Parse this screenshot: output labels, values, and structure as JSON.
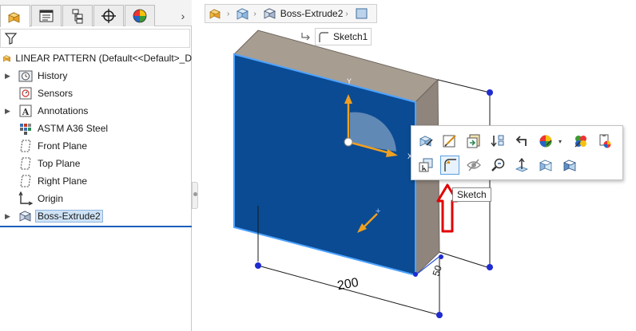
{
  "panel_tabs": [
    {
      "name": "featuremanager",
      "icon": "part-icon"
    },
    {
      "name": "propertymanager",
      "icon": "property-manager-icon"
    },
    {
      "name": "configurationmanager",
      "icon": "configuration-icon"
    },
    {
      "name": "dimxpertmanager",
      "icon": "crosshair-icon"
    },
    {
      "name": "displaymanager",
      "icon": "appearance-icon"
    }
  ],
  "tree": {
    "root": "LINEAR PATTERN  (Default<<Default>_D",
    "items": [
      {
        "label": "History",
        "icon": "history-folder-icon",
        "expandable": true
      },
      {
        "label": "Sensors",
        "icon": "sensor-icon",
        "expandable": false
      },
      {
        "label": "Annotations",
        "icon": "annotations-icon",
        "expandable": true
      },
      {
        "label": "ASTM A36 Steel",
        "icon": "material-icon",
        "expandable": false
      },
      {
        "label": "Front Plane",
        "icon": "plane-icon",
        "expandable": false
      },
      {
        "label": "Top Plane",
        "icon": "plane-icon",
        "expandable": false
      },
      {
        "label": "Right Plane",
        "icon": "plane-icon",
        "expandable": false
      },
      {
        "label": "Origin",
        "icon": "origin-icon",
        "expandable": false
      },
      {
        "label": "Boss-Extrude2",
        "icon": "extrude-icon",
        "expandable": true,
        "selected": true
      }
    ]
  },
  "breadcrumb": {
    "feature": "Boss-Extrude2",
    "sketch": "Sketch1"
  },
  "viewport": {
    "dim_width": "200",
    "dim_depth": "50",
    "axis_y": "Y",
    "axis_x": "X"
  },
  "context_toolbar": {
    "row1": [
      "edit-feature-icon",
      "edit-sketch-icon",
      "suppress-icon",
      "rollback-icon",
      "parent-child-icon",
      "appearance-icon",
      "apply-scene-icon",
      "zoom-selection-icon"
    ],
    "row2": [
      "select-other-icon",
      "sketch-icon",
      "hide-icon",
      "zoom-to-icon",
      "normal-to-icon",
      "view-orientation-icon",
      "display-style-icon"
    ]
  },
  "tooltip": "Sketch",
  "colors": {
    "face": "#0b4b93",
    "top_face": "#a79d91",
    "side_face": "#8f857c",
    "selection_edge": "#4da3ff",
    "annotation_arrow": "#e20000",
    "dim_point": "#1f2bd1"
  }
}
